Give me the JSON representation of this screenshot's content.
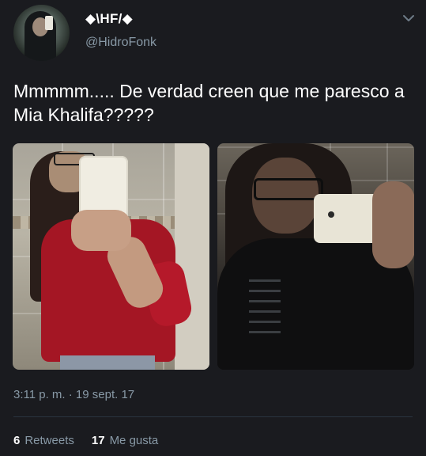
{
  "author": {
    "display_name": "◆\\HF/◆",
    "handle": "@HidroFonk"
  },
  "tweet": {
    "text": "Mmmmm..... De verdad creen que me paresco a Mia Khalifa?????",
    "timestamp": "3:11 p. m. · 19 sept. 17"
  },
  "stats": {
    "retweets_count": "6",
    "retweets_label": "Retweets",
    "likes_count": "17",
    "likes_label": "Me gusta"
  },
  "icons": {
    "menu": "chevron-down-icon"
  },
  "colors": {
    "background": "#1a1b1f",
    "secondary_text": "#8899a6",
    "primary_text": "#ffffff"
  }
}
